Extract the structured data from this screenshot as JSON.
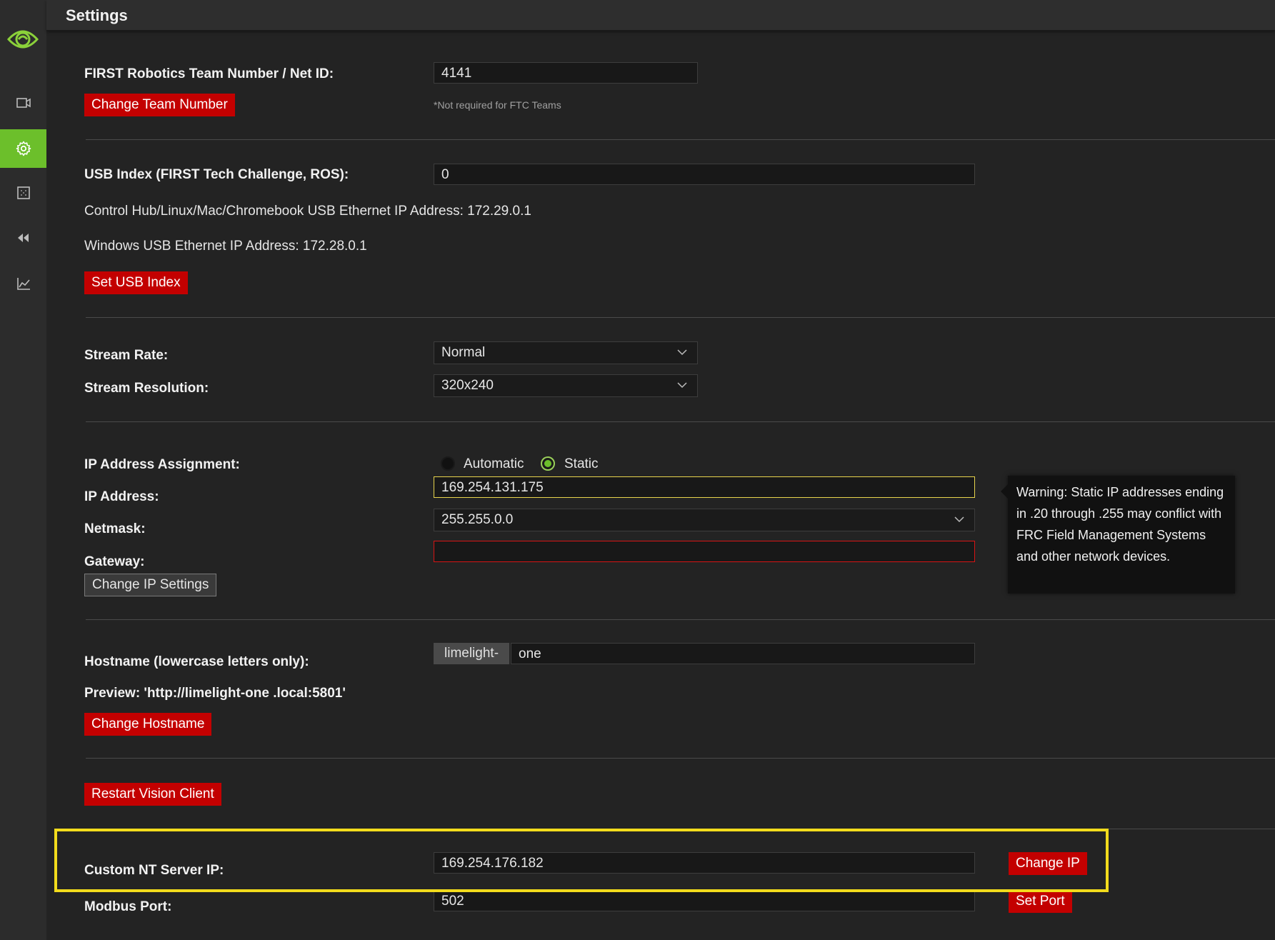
{
  "header": {
    "title": "Settings"
  },
  "sidebar": {
    "items": [
      {
        "name": "camera-icon",
        "active": false
      },
      {
        "name": "gear-icon",
        "active": true
      },
      {
        "name": "grid-icon",
        "active": false
      },
      {
        "name": "rewind-icon",
        "active": false
      },
      {
        "name": "chart-icon",
        "active": false
      }
    ],
    "accent_color": "#6cbf2b"
  },
  "team": {
    "label": "FIRST Robotics Team Number / Net ID:",
    "value": "4141",
    "button": "Change Team Number",
    "hint": "*Not required for FTC Teams"
  },
  "usb": {
    "label": "USB Index (FIRST Tech Challenge, ROS):",
    "value": "0",
    "line1": "Control Hub/Linux/Mac/Chromebook USB Ethernet IP Address: 172.29.0.1",
    "line2": "Windows USB Ethernet IP Address: 172.28.0.1",
    "button": "Set USB Index"
  },
  "stream": {
    "rate_label": "Stream Rate:",
    "rate_value": "Normal",
    "res_label": "Stream Resolution:",
    "res_value": "320x240"
  },
  "ip": {
    "assign_label": "IP Address Assignment:",
    "opt_auto": "Automatic",
    "opt_static": "Static",
    "selected": "Static",
    "address_label": "IP Address:",
    "address_value": "169.254.131.175",
    "netmask_label": "Netmask:",
    "netmask_value": "255.255.0.0",
    "gateway_label": "Gateway:",
    "gateway_value": "",
    "button": "Change IP Settings",
    "warning": "Warning: Static IP addresses ending in .20 through .255 may conflict with FRC Field Management Systems and other network devices."
  },
  "hostname": {
    "label": "Hostname (lowercase letters only):",
    "prefix": "limelight-",
    "value": "one",
    "preview": "Preview: 'http://limelight-one .local:5801'",
    "button": "Change Hostname"
  },
  "restart": {
    "button": "Restart Vision Client"
  },
  "nt": {
    "label": "Custom NT Server IP:",
    "value": "169.254.176.182",
    "button": "Change IP"
  },
  "modbus": {
    "label": "Modbus Port:",
    "value": "502",
    "button": "Set Port"
  },
  "colors": {
    "button_red": "#c30000",
    "highlight": "#f2db1c",
    "focus_border": "#e8d44d",
    "error_border": "#d71414"
  }
}
